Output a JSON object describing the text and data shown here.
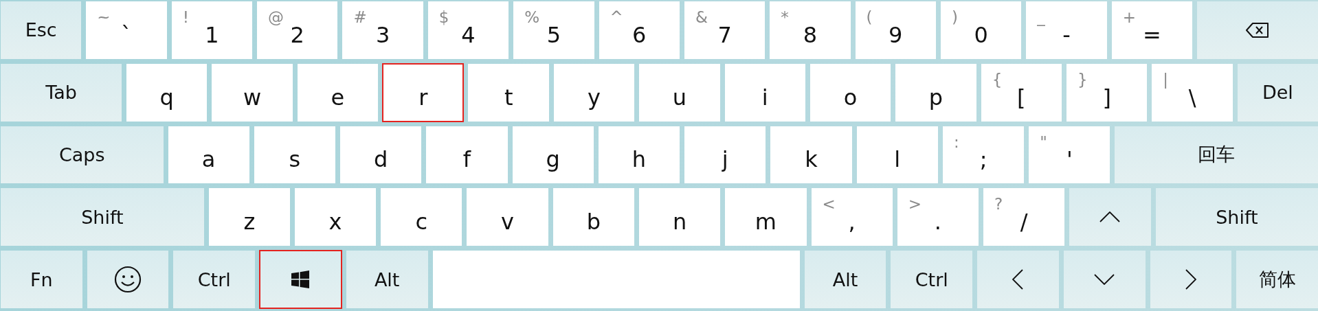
{
  "rows": [
    {
      "keys": [
        {
          "kind": "function",
          "label": "Esc",
          "highlighted": false
        },
        {
          "kind": "char",
          "shift": "~",
          "label": "`",
          "highlighted": false
        },
        {
          "kind": "char",
          "shift": "!",
          "label": "1",
          "highlighted": false
        },
        {
          "kind": "char",
          "shift": "@",
          "label": "2",
          "highlighted": false
        },
        {
          "kind": "char",
          "shift": "#",
          "label": "3",
          "highlighted": false
        },
        {
          "kind": "char",
          "shift": "$",
          "label": "4",
          "highlighted": false
        },
        {
          "kind": "char",
          "shift": "%",
          "label": "5",
          "highlighted": false
        },
        {
          "kind": "char",
          "shift": "^",
          "label": "6",
          "highlighted": false
        },
        {
          "kind": "char",
          "shift": "&",
          "label": "7",
          "highlighted": false
        },
        {
          "kind": "char",
          "shift": "*",
          "label": "8",
          "highlighted": false
        },
        {
          "kind": "char",
          "shift": "(",
          "label": "9",
          "highlighted": false
        },
        {
          "kind": "char",
          "shift": ")",
          "label": "0",
          "highlighted": false
        },
        {
          "kind": "char",
          "shift": "_",
          "label": "-",
          "highlighted": false
        },
        {
          "kind": "char",
          "shift": "+",
          "label": "=",
          "highlighted": false
        },
        {
          "kind": "backspace",
          "highlighted": false
        }
      ]
    },
    {
      "keys": [
        {
          "kind": "function",
          "label": "Tab",
          "highlighted": false
        },
        {
          "kind": "char",
          "label": "q",
          "highlighted": false
        },
        {
          "kind": "char",
          "label": "w",
          "highlighted": false
        },
        {
          "kind": "char",
          "label": "e",
          "highlighted": false
        },
        {
          "kind": "char",
          "label": "r",
          "highlighted": true
        },
        {
          "kind": "char",
          "label": "t",
          "highlighted": false
        },
        {
          "kind": "char",
          "label": "y",
          "highlighted": false
        },
        {
          "kind": "char",
          "label": "u",
          "highlighted": false
        },
        {
          "kind": "char",
          "label": "i",
          "highlighted": false
        },
        {
          "kind": "char",
          "label": "o",
          "highlighted": false
        },
        {
          "kind": "char",
          "label": "p",
          "highlighted": false
        },
        {
          "kind": "char",
          "shift": "{",
          "label": "[",
          "highlighted": false
        },
        {
          "kind": "char",
          "shift": "}",
          "label": "]",
          "highlighted": false
        },
        {
          "kind": "char",
          "shift": "|",
          "label": "\\",
          "highlighted": false
        },
        {
          "kind": "function",
          "label": "Del",
          "highlighted": false
        }
      ]
    },
    {
      "keys": [
        {
          "kind": "function",
          "label": "Caps",
          "highlighted": false
        },
        {
          "kind": "char",
          "label": "a",
          "highlighted": false
        },
        {
          "kind": "char",
          "label": "s",
          "highlighted": false
        },
        {
          "kind": "char",
          "label": "d",
          "highlighted": false
        },
        {
          "kind": "char",
          "label": "f",
          "highlighted": false
        },
        {
          "kind": "char",
          "label": "g",
          "highlighted": false
        },
        {
          "kind": "char",
          "label": "h",
          "highlighted": false
        },
        {
          "kind": "char",
          "label": "j",
          "highlighted": false
        },
        {
          "kind": "char",
          "label": "k",
          "highlighted": false
        },
        {
          "kind": "char",
          "label": "l",
          "highlighted": false
        },
        {
          "kind": "char",
          "shift": ":",
          "label": ";",
          "highlighted": false
        },
        {
          "kind": "char",
          "shift": "\"",
          "label": "'",
          "highlighted": false
        },
        {
          "kind": "function",
          "label": "回车",
          "highlighted": false
        }
      ]
    },
    {
      "keys": [
        {
          "kind": "function",
          "label": "Shift",
          "highlighted": false
        },
        {
          "kind": "char",
          "label": "z",
          "highlighted": false
        },
        {
          "kind": "char",
          "label": "x",
          "highlighted": false
        },
        {
          "kind": "char",
          "label": "c",
          "highlighted": false
        },
        {
          "kind": "char",
          "label": "v",
          "highlighted": false
        },
        {
          "kind": "char",
          "label": "b",
          "highlighted": false
        },
        {
          "kind": "char",
          "label": "n",
          "highlighted": false
        },
        {
          "kind": "char",
          "label": "m",
          "highlighted": false
        },
        {
          "kind": "char",
          "shift": "<",
          "label": ",",
          "highlighted": false
        },
        {
          "kind": "char",
          "shift": ">",
          "label": ".",
          "highlighted": false
        },
        {
          "kind": "char",
          "shift": "?",
          "label": "/",
          "highlighted": false
        },
        {
          "kind": "arrow-up",
          "highlighted": false
        },
        {
          "kind": "function",
          "label": "Shift",
          "highlighted": false
        }
      ]
    },
    {
      "keys": [
        {
          "kind": "function",
          "label": "Fn",
          "highlighted": false
        },
        {
          "kind": "emoji",
          "highlighted": false
        },
        {
          "kind": "function",
          "label": "Ctrl",
          "highlighted": false
        },
        {
          "kind": "windows",
          "highlighted": true
        },
        {
          "kind": "function",
          "label": "Alt",
          "highlighted": false
        },
        {
          "kind": "space",
          "highlighted": false
        },
        {
          "kind": "function",
          "label": "Alt",
          "highlighted": false
        },
        {
          "kind": "function",
          "label": "Ctrl",
          "highlighted": false
        },
        {
          "kind": "arrow-left",
          "highlighted": false
        },
        {
          "kind": "arrow-down",
          "highlighted": false
        },
        {
          "kind": "arrow-right",
          "highlighted": false
        },
        {
          "kind": "function",
          "label": "简体",
          "highlighted": false
        }
      ]
    }
  ]
}
